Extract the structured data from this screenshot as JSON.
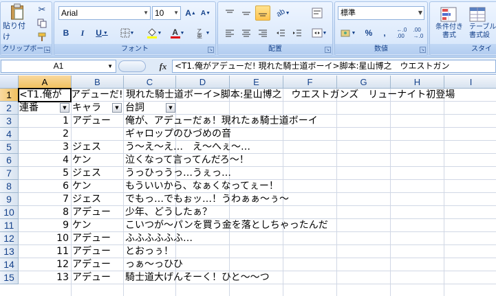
{
  "ribbon": {
    "clipboard": {
      "paste_label": "貼り付け",
      "group_label": "クリップボー..."
    },
    "font": {
      "name": "Arial",
      "size": "10",
      "bold": "B",
      "italic": "I",
      "underline": "U",
      "group_label": "フォント",
      "grow": "A",
      "shrink": "A",
      "color_letter": "A"
    },
    "alignment": {
      "group_label": "配置"
    },
    "number": {
      "format": "標準",
      "percent": "%",
      "comma": ",",
      "group_label": "数値"
    },
    "styles": {
      "conditional_label_1": "条件付き",
      "conditional_label_2": "書式",
      "table_label_1": "テーブルと",
      "table_label_2": "書式設",
      "group_label": "スタイ"
    },
    "accent": "#ffc34d"
  },
  "formula_bar": {
    "name_box": "A1",
    "fx": "fx",
    "content": "<T1.俺がアデューだ! 現れた騎士道ボーイ>脚本:星山博之　ウエストガン"
  },
  "columns": [
    "A",
    "B",
    "C",
    "D",
    "E",
    "F",
    "G",
    "H",
    "I"
  ],
  "row_numbers": [
    "1",
    "2",
    "3",
    "4",
    "5",
    "6",
    "7",
    "8",
    "9",
    "10",
    "11",
    "12",
    "13",
    "14",
    "15"
  ],
  "title_row": {
    "a1_text": "<T1.俺が",
    "overflow_text": "アデューだ! 現れた騎士道ボーイ>脚本:星山博之　ウエストガンズ　リューナイト初登場"
  },
  "headers": [
    "連番",
    "キャラ",
    "台詞"
  ],
  "rows": [
    {
      "num": "1",
      "chara": "アデュー",
      "line": "俺が、アデューだぁ！現れたぁ騎士道ボーイ"
    },
    {
      "num": "2",
      "chara": "",
      "line": "ギャロップのひづめの音"
    },
    {
      "num": "3",
      "chara": "ジェス",
      "line": "う～え～え…　え～へぇ～…"
    },
    {
      "num": "4",
      "chara": "ケン",
      "line": "泣くなって言ってんだろ～！"
    },
    {
      "num": "5",
      "chara": "ジェス",
      "line": "うっひっうっ…うぇっ…"
    },
    {
      "num": "6",
      "chara": "ケン",
      "line": "もういいから、なぁくなってぇー！"
    },
    {
      "num": "7",
      "chara": "ジェス",
      "line": "でもっ…でもぉッ…！うわぁぁ～ぅ～"
    },
    {
      "num": "8",
      "chara": "アデュー",
      "line": "少年、どうしたぁ？"
    },
    {
      "num": "9",
      "chara": "ケン",
      "line": "こいつが～パンを買う金を落としちゃったんだ"
    },
    {
      "num": "10",
      "chara": "アデュー",
      "line": "ふふふふふふ…"
    },
    {
      "num": "11",
      "chara": "アデュー",
      "line": "とおっぅ！"
    },
    {
      "num": "12",
      "chara": "アデュー",
      "line": "っぁ～っひひ"
    },
    {
      "num": "13",
      "chara": "アデュー",
      "line": "騎士道大げんそーく！ひと～～つ"
    }
  ]
}
